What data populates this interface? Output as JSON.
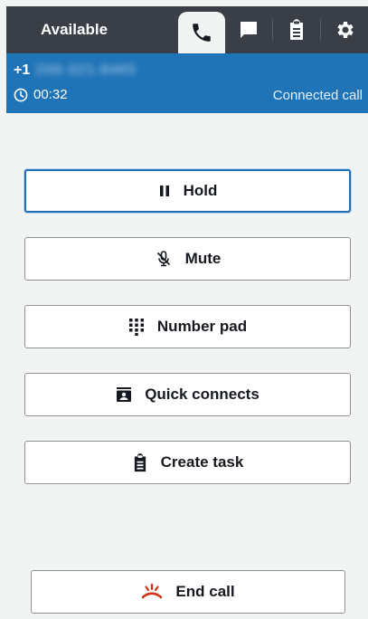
{
  "header": {
    "status_label": "Available",
    "tabs": [
      {
        "name": "phone",
        "icon": "phone-icon",
        "active": true
      },
      {
        "name": "chat",
        "icon": "chat-icon",
        "active": false
      },
      {
        "name": "tasks",
        "icon": "clipboard-icon",
        "active": false
      },
      {
        "name": "settings",
        "icon": "gear-icon",
        "active": false
      }
    ]
  },
  "call": {
    "country_code": "+1",
    "number": "206-321-8465",
    "duration": "00:32",
    "state": "Connected call"
  },
  "actions": {
    "hold": "Hold",
    "mute": "Mute",
    "number_pad": "Number pad",
    "quick_connects": "Quick connects",
    "create_task": "Create task",
    "end_call": "End call"
  },
  "colors": {
    "topbar": "#3a3f47",
    "call_banner": "#1f73b7",
    "focus_border": "#1f6fbf",
    "end_call_icon": "#d13212"
  }
}
